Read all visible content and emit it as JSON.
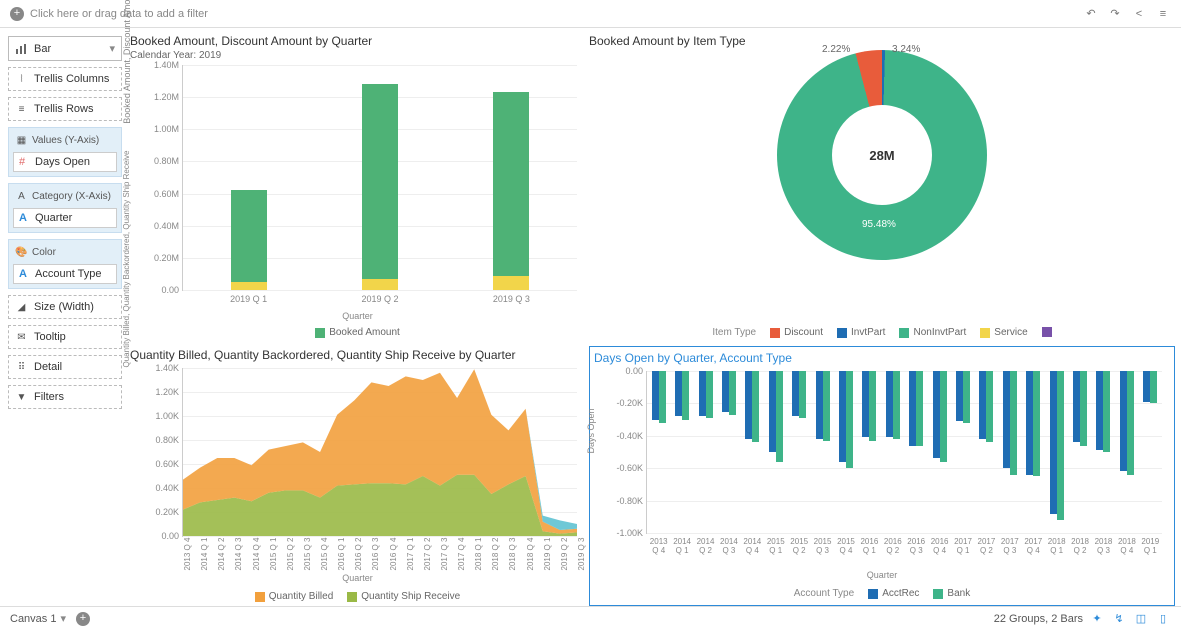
{
  "topbar": {
    "filter_placeholder": "Click here or drag data to add a filter",
    "icons": [
      "undo",
      "redo",
      "share",
      "menu"
    ]
  },
  "left_panel": {
    "viz_type": "Bar",
    "trellis_columns": "Trellis Columns",
    "trellis_rows": "Trellis Rows",
    "values_group_title": "Values (Y-Axis)",
    "values_chip": "Days Open",
    "category_group_title": "Category (X-Axis)",
    "category_chip": "Quarter",
    "color_group_title": "Color",
    "color_chip": "Account Type",
    "size": "Size (Width)",
    "tooltip": "Tooltip",
    "detail": "Detail",
    "filters": "Filters"
  },
  "chart1": {
    "title": "Booked Amount, Discount Amount by Quarter",
    "subtitle": "Calendar Year: 2019",
    "ylabel": "Booked Amount, Discount Amount",
    "xlabel": "Quarter",
    "legend": [
      "Booked Amount"
    ],
    "yticks": [
      "0.00",
      "0.20M",
      "0.40M",
      "0.60M",
      "0.80M",
      "1.00M",
      "1.20M",
      "1.40M"
    ]
  },
  "chart2": {
    "title": "Booked Amount by Item Type",
    "legend_title": "Item Type",
    "legend": [
      "Discount",
      "InvtPart",
      "NonInvtPart",
      "Service"
    ],
    "center": "28M",
    "labels": [
      "2.22%",
      "3.24%",
      "95.48%"
    ]
  },
  "chart3": {
    "title": "Quantity Billed, Quantity Backordered, Quantity Ship Receive by Quarter",
    "ylabel": "Quantity Billed, Quantity Backordered,\nQuantity Ship Receive",
    "xlabel": "Quarter",
    "legend": [
      "Quantity Billed",
      "Quantity Ship Receive"
    ],
    "yticks": [
      "0.00",
      "0.20K",
      "0.40K",
      "0.60K",
      "0.80K",
      "1.00K",
      "1.20K",
      "1.40K"
    ]
  },
  "chart4": {
    "title": "Days Open by Quarter, Account Type",
    "ylabel": "Days Open",
    "xlabel": "Quarter",
    "legend_title": "Account Type",
    "legend": [
      "AcctRec",
      "Bank"
    ],
    "yticks": [
      "-1.00K",
      "-0.80K",
      "-0.60K",
      "-0.40K",
      "-0.20K",
      "0.00"
    ]
  },
  "bottombar": {
    "canvas": "Canvas 1",
    "status": "22 Groups, 2 Bars"
  },
  "colors": {
    "green": "#4eb276",
    "yellow": "#f2d54a",
    "orange": "#f2a03d",
    "olive": "#9ab946",
    "teal": "#5fc2d1",
    "blue": "#1f6db3",
    "green2": "#3eb489",
    "red": "#e85c3b",
    "purple": "#7851a9"
  },
  "chart_data": [
    {
      "type": "bar",
      "title": "Booked Amount, Discount Amount by Quarter",
      "subtitle": "Calendar Year: 2019",
      "xlabel": "Quarter",
      "ylabel": "Booked Amount, Discount Amount",
      "ylim": [
        0,
        1400000
      ],
      "categories": [
        "2019 Q 1",
        "2019 Q 2",
        "2019 Q 3"
      ],
      "series": [
        {
          "name": "Discount Amount",
          "color": "#f2d54a",
          "values": [
            50000,
            70000,
            90000
          ]
        },
        {
          "name": "Booked Amount",
          "color": "#4eb276",
          "values": [
            570000,
            1210000,
            1140000
          ]
        }
      ],
      "stacked": true
    },
    {
      "type": "pie",
      "title": "Booked Amount by Item Type",
      "center_label": "28M",
      "donut": true,
      "series": [
        {
          "name": "Service",
          "color": "#f2d54a",
          "value": 0.0222
        },
        {
          "name": "InvtPart",
          "color": "#1f6db3",
          "value": 0.0324
        },
        {
          "name": "NonInvtPart",
          "color": "#3eb489",
          "value": 0.9548
        },
        {
          "name": "Discount",
          "color": "#e85c3b",
          "value": 0.0006
        }
      ]
    },
    {
      "type": "area",
      "title": "Quantity Billed, Quantity Backordered, Quantity Ship Receive by Quarter",
      "xlabel": "Quarter",
      "ylabel": "Quantity Billed, Quantity Backordered, Quantity Ship Receive",
      "ylim": [
        0,
        1400
      ],
      "stacked": true,
      "categories": [
        "2013 Q 4",
        "2014 Q 1",
        "2014 Q 2",
        "2014 Q 3",
        "2014 Q 4",
        "2015 Q 1",
        "2015 Q 2",
        "2015 Q 3",
        "2015 Q 4",
        "2016 Q 1",
        "2016 Q 2",
        "2016 Q 3",
        "2016 Q 4",
        "2017 Q 1",
        "2017 Q 2",
        "2017 Q 3",
        "2017 Q 4",
        "2018 Q 1",
        "2018 Q 2",
        "2018 Q 3",
        "2018 Q 4",
        "2019 Q 1",
        "2019 Q 2",
        "2019 Q 3"
      ],
      "series": [
        {
          "name": "Quantity Ship Receive",
          "color": "#9ab946",
          "values": [
            220,
            280,
            300,
            320,
            290,
            360,
            380,
            380,
            320,
            420,
            430,
            440,
            440,
            430,
            500,
            420,
            510,
            510,
            350,
            430,
            500,
            40,
            20,
            30
          ]
        },
        {
          "name": "Quantity Billed",
          "color": "#f2a03d",
          "values": [
            250,
            290,
            350,
            330,
            300,
            360,
            370,
            400,
            380,
            590,
            700,
            840,
            810,
            900,
            800,
            940,
            640,
            880,
            660,
            450,
            560,
            80,
            30,
            30
          ]
        },
        {
          "name": "Quantity Backordered",
          "color": "#5fc2d1",
          "values": [
            0,
            0,
            0,
            0,
            0,
            0,
            0,
            0,
            0,
            0,
            0,
            0,
            0,
            0,
            0,
            0,
            0,
            0,
            0,
            0,
            0,
            50,
            80,
            40
          ]
        }
      ]
    },
    {
      "type": "bar",
      "title": "Days Open by Quarter, Account Type",
      "xlabel": "Quarter",
      "ylabel": "Days Open",
      "ylim": [
        -1000,
        0
      ],
      "categories": [
        "2013 Q 4",
        "2014 Q 1",
        "2014 Q 2",
        "2014 Q 3",
        "2014 Q 4",
        "2015 Q 1",
        "2015 Q 2",
        "2015 Q 3",
        "2015 Q 4",
        "2016 Q 1",
        "2016 Q 2",
        "2016 Q 3",
        "2016 Q 4",
        "2017 Q 1",
        "2017 Q 2",
        "2017 Q 3",
        "2017 Q 4",
        "2018 Q 1",
        "2018 Q 2",
        "2018 Q 3",
        "2018 Q 4",
        "2019 Q 1"
      ],
      "series": [
        {
          "name": "AcctRec",
          "color": "#1f6db3",
          "values": [
            -300,
            -280,
            -280,
            -250,
            -420,
            -500,
            -280,
            -420,
            -560,
            -410,
            -410,
            -460,
            -540,
            -310,
            -420,
            -600,
            -640,
            -880,
            -440,
            -490,
            -620,
            -190
          ]
        },
        {
          "name": "Bank",
          "color": "#3eb489",
          "values": [
            -320,
            -300,
            -290,
            -270,
            -440,
            -560,
            -290,
            -430,
            -600,
            -430,
            -420,
            -460,
            -560,
            -320,
            -440,
            -640,
            -650,
            -920,
            -460,
            -500,
            -640,
            -200
          ]
        }
      ]
    }
  ]
}
